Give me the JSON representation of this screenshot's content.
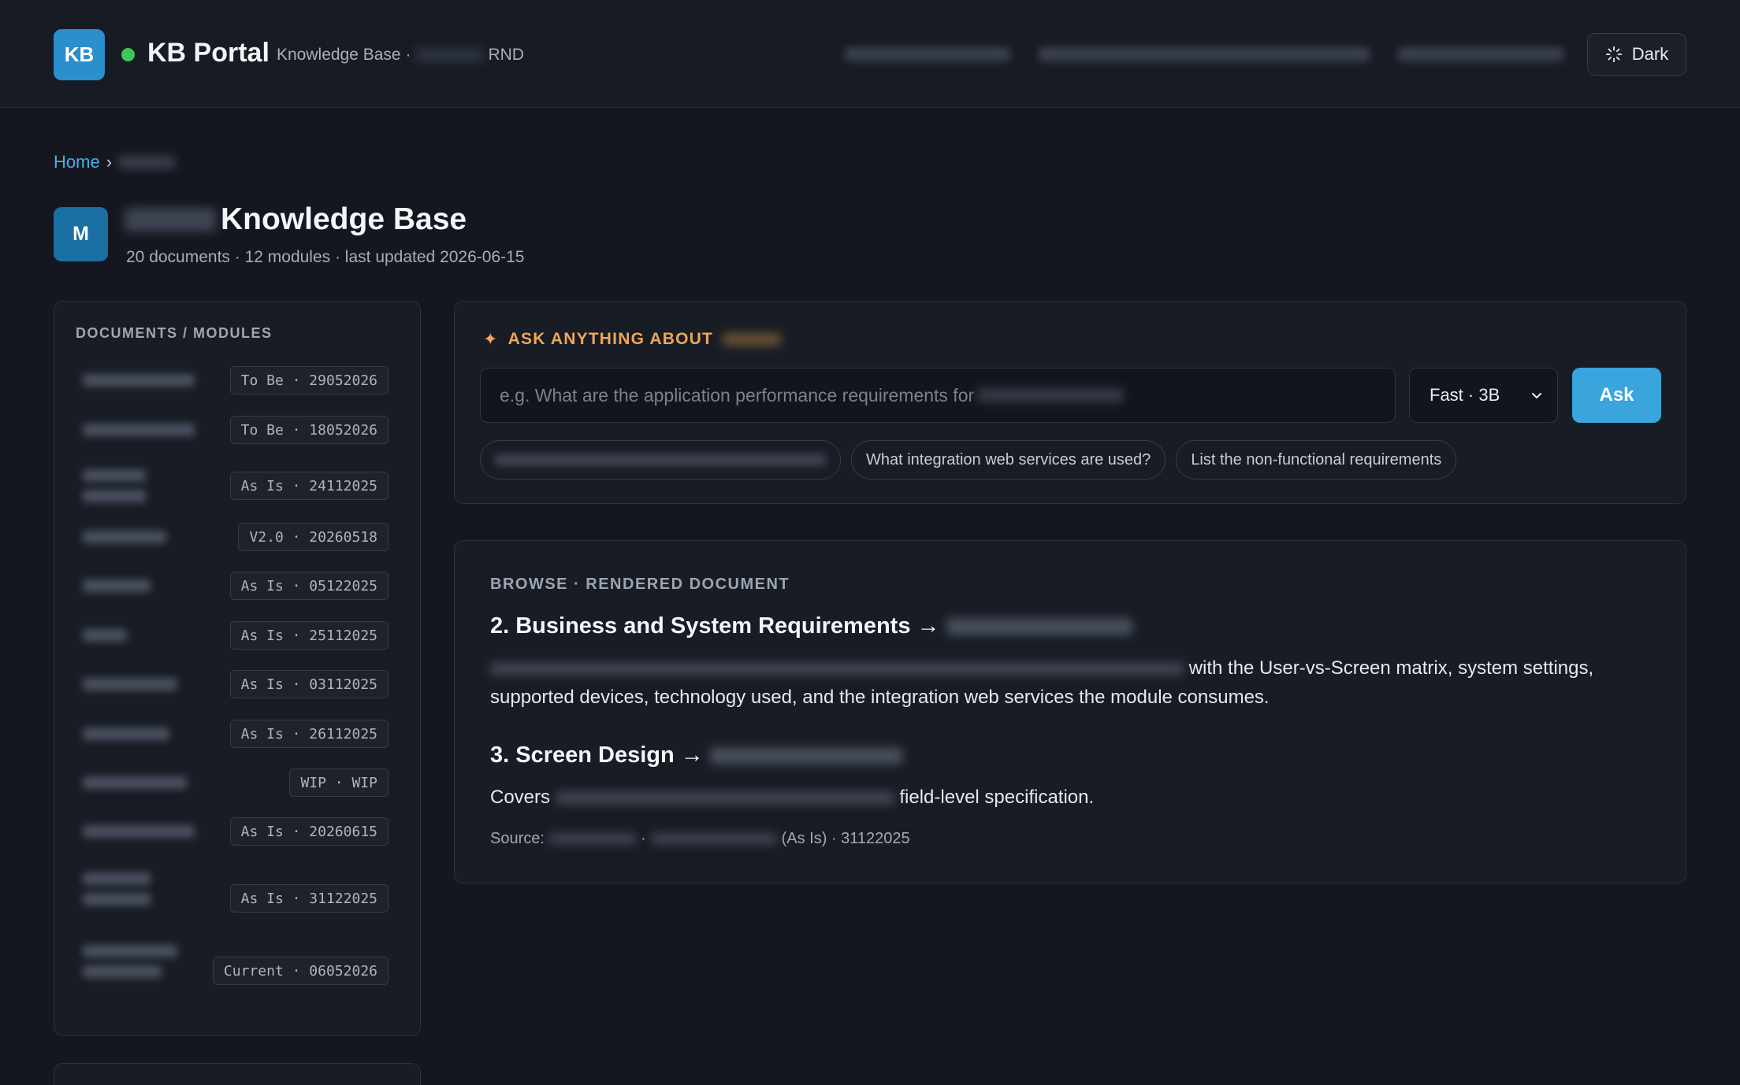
{
  "header": {
    "logo_text": "KB",
    "brand": "KB Portal",
    "subtitle_prefix": "Knowledge Base ·",
    "subtitle_suffix": "RND",
    "theme_label": "Dark",
    "theme_icon": "loader-icon"
  },
  "breadcrumb": {
    "home": "Home",
    "separator": "›"
  },
  "title": {
    "avatar": "M",
    "suffix": "Knowledge Base",
    "meta": "20 documents · 12 modules · last updated 2026-06-15"
  },
  "sidebar": {
    "title": "DOCUMENTS / MODULES",
    "items": [
      {
        "badge": "To Be · 29052026"
      },
      {
        "badge": "To Be · 18052026"
      },
      {
        "badge": "As Is · 24112025"
      },
      {
        "badge": "V2.0 · 20260518"
      },
      {
        "badge": "As Is · 05122025"
      },
      {
        "badge": "As Is · 25112025"
      },
      {
        "badge": "As Is · 03112025"
      },
      {
        "badge": "As Is · 26112025"
      },
      {
        "badge": "WIP · WIP"
      },
      {
        "badge": "As Is · 20260615"
      },
      {
        "badge": "As Is · 31122025"
      },
      {
        "badge": "Current · 06052026"
      }
    ]
  },
  "ask": {
    "label": "ASK ANYTHING ABOUT",
    "placeholder": "e.g. What are the application performance requirements for",
    "model": "Fast · 3B",
    "button": "Ask",
    "chips": [
      "What integration web services are used?",
      "List the non-functional requirements"
    ]
  },
  "browse": {
    "label": "BROWSE · RENDERED DOCUMENT",
    "sections": [
      {
        "heading": "2. Business and System Requirements →",
        "text_after": "with the User-vs-Screen matrix, system settings, supported devices, technology used, and the integration web services the module consumes."
      },
      {
        "heading": "3. Screen Design →",
        "text_before": "Covers",
        "text_after": "field-level specification."
      }
    ],
    "source_label": "Source:",
    "source_dot": "·",
    "source_suffix": "(As Is) · 31122025"
  }
}
